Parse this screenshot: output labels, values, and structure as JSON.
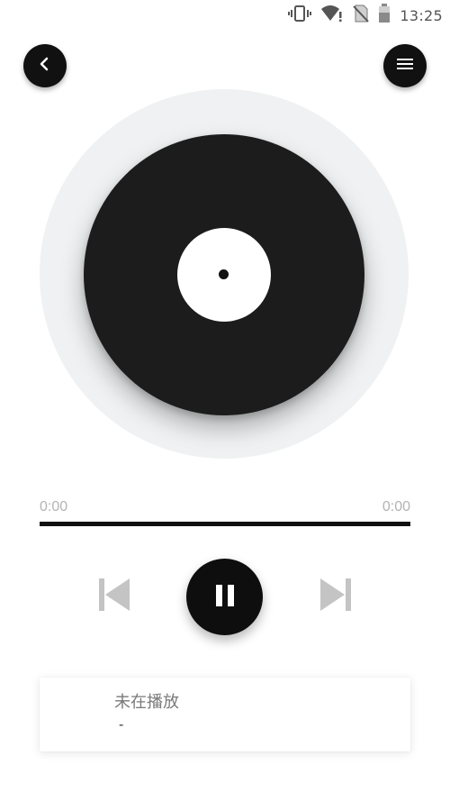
{
  "status_bar": {
    "time": "13:25",
    "icons": [
      "vibrate-icon",
      "wifi-icon",
      "no-sim-icon",
      "battery-icon"
    ]
  },
  "header": {
    "back_icon": "chevron-left-icon",
    "menu_icon": "hamburger-menu-icon"
  },
  "player": {
    "current_time": "0:00",
    "total_time": "0:00",
    "progress": 0,
    "controls": {
      "prev_icon": "skip-previous-icon",
      "play_pause_icon": "pause-icon",
      "next_icon": "skip-next-icon"
    }
  },
  "now_playing": {
    "title": "未在播放",
    "artist": "-"
  },
  "colors": {
    "accent": "#111111",
    "disc_outer": "#eff1f2",
    "disc": "#1c1c1c",
    "time_text": "#b3b3b3",
    "control_disabled": "#c4c4c4"
  }
}
